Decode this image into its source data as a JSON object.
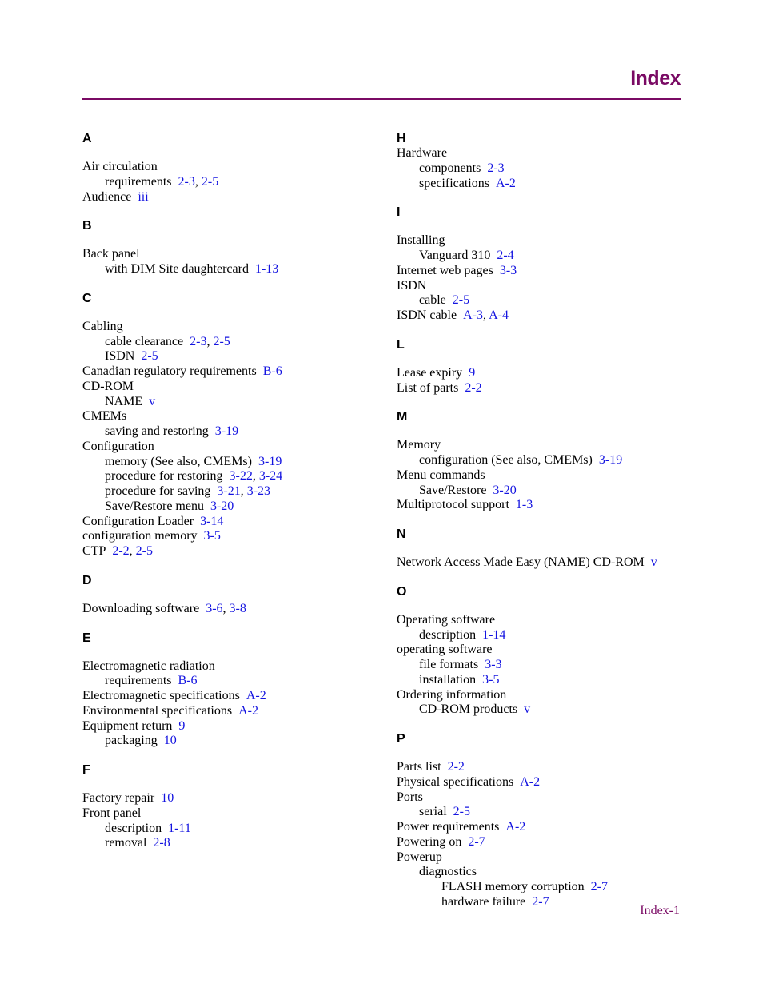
{
  "header": {
    "title": "Index"
  },
  "footer": {
    "page_label": "Index-1"
  },
  "colors": {
    "accent": "#7a0a64",
    "link": "#1414e0"
  },
  "left_column": [
    {
      "letter": "A",
      "entries": [
        {
          "level": 1,
          "text": "Air circulation",
          "refs": []
        },
        {
          "level": 2,
          "text": "requirements",
          "refs": [
            "2-3",
            "2-5"
          ]
        },
        {
          "level": 1,
          "text": "Audience",
          "refs": [
            "iii"
          ]
        }
      ]
    },
    {
      "letter": "B",
      "entries": [
        {
          "level": 1,
          "text": "Back panel",
          "refs": []
        },
        {
          "level": 2,
          "text": "with DIM Site daughtercard",
          "refs": [
            "1-13"
          ]
        }
      ]
    },
    {
      "letter": "C",
      "entries": [
        {
          "level": 1,
          "text": "Cabling",
          "refs": []
        },
        {
          "level": 2,
          "text": "cable clearance",
          "refs": [
            "2-3",
            "2-5"
          ]
        },
        {
          "level": 2,
          "text": "ISDN",
          "refs": [
            "2-5"
          ]
        },
        {
          "level": 1,
          "text": "Canadian regulatory requirements",
          "refs": [
            "B-6"
          ]
        },
        {
          "level": 1,
          "text": "CD-ROM",
          "refs": []
        },
        {
          "level": 2,
          "text": "NAME",
          "refs": [
            "v"
          ]
        },
        {
          "level": 1,
          "text": "CMEMs",
          "refs": []
        },
        {
          "level": 2,
          "text": "saving and restoring",
          "refs": [
            "3-19"
          ]
        },
        {
          "level": 1,
          "text": "Configuration",
          "refs": []
        },
        {
          "level": 2,
          "text": "memory (See also, CMEMs)",
          "refs": [
            "3-19"
          ]
        },
        {
          "level": 2,
          "text": "procedure for restoring",
          "refs": [
            "3-22",
            "3-24"
          ]
        },
        {
          "level": 2,
          "text": "procedure for saving",
          "refs": [
            "3-21",
            "3-23"
          ]
        },
        {
          "level": 2,
          "text": "Save/Restore menu",
          "refs": [
            "3-20"
          ]
        },
        {
          "level": 1,
          "text": "Configuration Loader",
          "refs": [
            "3-14"
          ]
        },
        {
          "level": 1,
          "text": "configuration memory",
          "refs": [
            "3-5"
          ]
        },
        {
          "level": 1,
          "text": "CTP",
          "refs": [
            "2-2",
            "2-5"
          ]
        }
      ]
    },
    {
      "letter": "D",
      "entries": [
        {
          "level": 1,
          "text": "Downloading software",
          "refs": [
            "3-6",
            "3-8"
          ]
        }
      ]
    },
    {
      "letter": "E",
      "entries": [
        {
          "level": 1,
          "text": "Electromagnetic radiation",
          "refs": []
        },
        {
          "level": 2,
          "text": "requirements",
          "refs": [
            "B-6"
          ]
        },
        {
          "level": 1,
          "text": "Electromagnetic specifications",
          "refs": [
            "A-2"
          ]
        },
        {
          "level": 1,
          "text": "Environmental specifications",
          "refs": [
            "A-2"
          ]
        },
        {
          "level": 1,
          "text": "Equipment return",
          "refs": [
            "9"
          ]
        },
        {
          "level": 2,
          "text": "packaging",
          "refs": [
            "10"
          ]
        }
      ]
    },
    {
      "letter": "F",
      "entries": [
        {
          "level": 1,
          "text": "Factory repair",
          "refs": [
            "10"
          ]
        },
        {
          "level": 1,
          "text": "Front panel",
          "refs": []
        },
        {
          "level": 2,
          "text": "description",
          "refs": [
            "1-11"
          ]
        },
        {
          "level": 2,
          "text": "removal",
          "refs": [
            "2-8"
          ]
        }
      ]
    }
  ],
  "right_column": [
    {
      "letter": "H",
      "tight": true,
      "entries": [
        {
          "level": 1,
          "text": "Hardware",
          "refs": []
        },
        {
          "level": 2,
          "text": "components",
          "refs": [
            "2-3"
          ]
        },
        {
          "level": 2,
          "text": "specifications",
          "refs": [
            "A-2"
          ]
        }
      ]
    },
    {
      "letter": "I",
      "entries": [
        {
          "level": 1,
          "text": "Installing",
          "refs": []
        },
        {
          "level": 2,
          "text": "Vanguard 310",
          "refs": [
            "2-4"
          ]
        },
        {
          "level": 1,
          "text": "Internet web pages",
          "refs": [
            "3-3"
          ]
        },
        {
          "level": 1,
          "text": "ISDN",
          "refs": []
        },
        {
          "level": 2,
          "text": "cable",
          "refs": [
            "2-5"
          ]
        },
        {
          "level": 1,
          "text": "ISDN cable",
          "refs": [
            "A-3",
            "A-4"
          ]
        }
      ]
    },
    {
      "letter": "L",
      "entries": [
        {
          "level": 1,
          "text": "Lease expiry",
          "refs": [
            "9"
          ]
        },
        {
          "level": 1,
          "text": "List of parts",
          "refs": [
            "2-2"
          ]
        }
      ]
    },
    {
      "letter": "M",
      "entries": [
        {
          "level": 1,
          "text": "Memory",
          "refs": []
        },
        {
          "level": 2,
          "text": "configuration (See also, CMEMs)",
          "refs": [
            "3-19"
          ]
        },
        {
          "level": 1,
          "text": "Menu commands",
          "refs": []
        },
        {
          "level": 2,
          "text": "Save/Restore",
          "refs": [
            "3-20"
          ]
        },
        {
          "level": 1,
          "text": "Multiprotocol support",
          "refs": [
            "1-3"
          ]
        }
      ]
    },
    {
      "letter": "N",
      "entries": [
        {
          "level": 1,
          "text": "Network Access Made Easy (NAME) CD-ROM",
          "refs": [
            "v"
          ]
        }
      ]
    },
    {
      "letter": "O",
      "entries": [
        {
          "level": 1,
          "text": "Operating software",
          "refs": []
        },
        {
          "level": 2,
          "text": "description",
          "refs": [
            "1-14"
          ]
        },
        {
          "level": 1,
          "text": "operating software",
          "refs": []
        },
        {
          "level": 2,
          "text": "file formats",
          "refs": [
            "3-3"
          ]
        },
        {
          "level": 2,
          "text": "installation",
          "refs": [
            "3-5"
          ]
        },
        {
          "level": 1,
          "text": "Ordering information",
          "refs": []
        },
        {
          "level": 2,
          "text": "CD-ROM products",
          "refs": [
            "v"
          ]
        }
      ]
    },
    {
      "letter": "P",
      "entries": [
        {
          "level": 1,
          "text": "Parts list",
          "refs": [
            "2-2"
          ]
        },
        {
          "level": 1,
          "text": "Physical specifications",
          "refs": [
            "A-2"
          ]
        },
        {
          "level": 1,
          "text": "Ports",
          "refs": []
        },
        {
          "level": 2,
          "text": "serial",
          "refs": [
            "2-5"
          ]
        },
        {
          "level": 1,
          "text": "Power requirements",
          "refs": [
            "A-2"
          ]
        },
        {
          "level": 1,
          "text": "Powering on",
          "refs": [
            "2-7"
          ]
        },
        {
          "level": 1,
          "text": "Powerup",
          "refs": []
        },
        {
          "level": 2,
          "text": "diagnostics",
          "refs": []
        },
        {
          "level": 3,
          "text": "FLASH memory corruption",
          "refs": [
            "2-7"
          ]
        },
        {
          "level": 3,
          "text": "hardware failure",
          "refs": [
            "2-7"
          ]
        }
      ]
    }
  ]
}
